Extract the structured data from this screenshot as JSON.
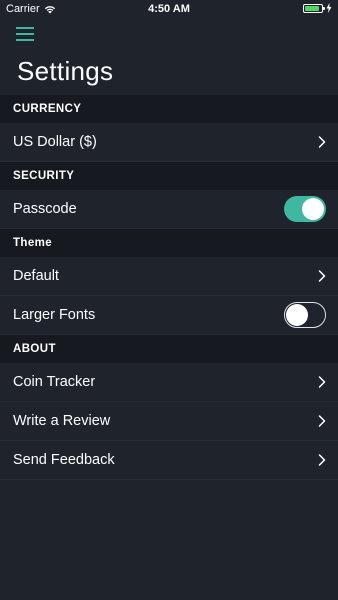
{
  "status_bar": {
    "carrier": "Carrier",
    "time": "4:50 AM",
    "battery_level": 0.9,
    "battery_color": "#4cd964"
  },
  "header": {
    "menu_icon": "hamburger-menu-icon",
    "title": "Settings"
  },
  "sections": {
    "currency": {
      "title": "CURRENCY",
      "items": [
        {
          "label": "US Dollar ($)",
          "control": "chevron"
        }
      ]
    },
    "security": {
      "title": "SECURITY",
      "items": [
        {
          "label": "Passcode",
          "control": "toggle",
          "value": true
        }
      ]
    },
    "theme": {
      "title": "Theme",
      "items": [
        {
          "label": "Default",
          "control": "chevron"
        },
        {
          "label": "Larger Fonts",
          "control": "toggle",
          "value": false
        }
      ]
    },
    "about": {
      "title": "ABOUT",
      "items": [
        {
          "label": "Coin Tracker",
          "control": "chevron"
        },
        {
          "label": "Write a Review",
          "control": "chevron"
        },
        {
          "label": "Send Feedback",
          "control": "chevron"
        }
      ]
    }
  },
  "colors": {
    "background": "#1e232c",
    "section_header_bg": "#161a20",
    "accent": "#3fb8a1"
  }
}
